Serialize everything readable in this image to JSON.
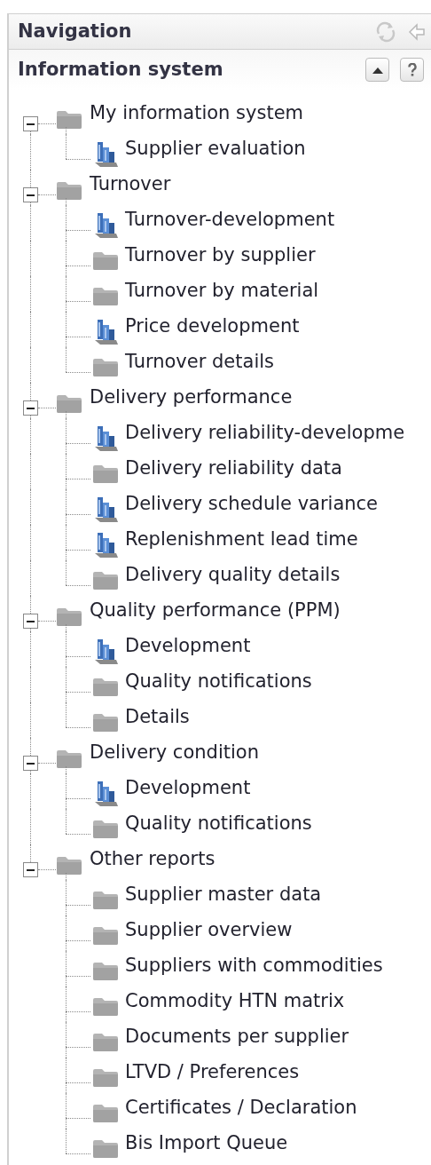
{
  "panel": {
    "title": "Navigation"
  },
  "section": {
    "title": "Information system"
  },
  "tree": [
    {
      "label": "My information system",
      "expanded": true,
      "children": [
        {
          "label": "Supplier evaluation",
          "kind": "report"
        }
      ]
    },
    {
      "label": "Turnover",
      "expanded": true,
      "children": [
        {
          "label": "Turnover-development",
          "kind": "report"
        },
        {
          "label": "Turnover by supplier",
          "kind": "folder"
        },
        {
          "label": "Turnover by material",
          "kind": "folder"
        },
        {
          "label": "Price development",
          "kind": "report"
        },
        {
          "label": "Turnover details",
          "kind": "folder"
        }
      ]
    },
    {
      "label": "Delivery performance",
      "expanded": true,
      "children": [
        {
          "label": "Delivery reliability-developme",
          "kind": "report"
        },
        {
          "label": "Delivery reliability data",
          "kind": "folder"
        },
        {
          "label": "Delivery schedule variance",
          "kind": "report"
        },
        {
          "label": "Replenishment lead time",
          "kind": "report"
        },
        {
          "label": "Delivery quality details",
          "kind": "folder"
        }
      ]
    },
    {
      "label": "Quality performance (PPM)",
      "expanded": true,
      "children": [
        {
          "label": "Development",
          "kind": "report"
        },
        {
          "label": "Quality notifications",
          "kind": "folder"
        },
        {
          "label": "Details",
          "kind": "folder"
        }
      ]
    },
    {
      "label": "Delivery condition",
      "expanded": true,
      "children": [
        {
          "label": "Development",
          "kind": "report"
        },
        {
          "label": "Quality notifications",
          "kind": "folder"
        }
      ]
    },
    {
      "label": "Other reports",
      "expanded": true,
      "children": [
        {
          "label": "Supplier master data",
          "kind": "folder"
        },
        {
          "label": "Supplier overview",
          "kind": "folder"
        },
        {
          "label": "Suppliers with commodities",
          "kind": "folder"
        },
        {
          "label": "Commodity HTN matrix",
          "kind": "folder"
        },
        {
          "label": "Documents per supplier",
          "kind": "folder"
        },
        {
          "label": "LTVD / Preferences",
          "kind": "folder"
        },
        {
          "label": "Certificates / Declaration",
          "kind": "folder"
        },
        {
          "label": "Bis Import Queue",
          "kind": "folder"
        }
      ]
    }
  ]
}
